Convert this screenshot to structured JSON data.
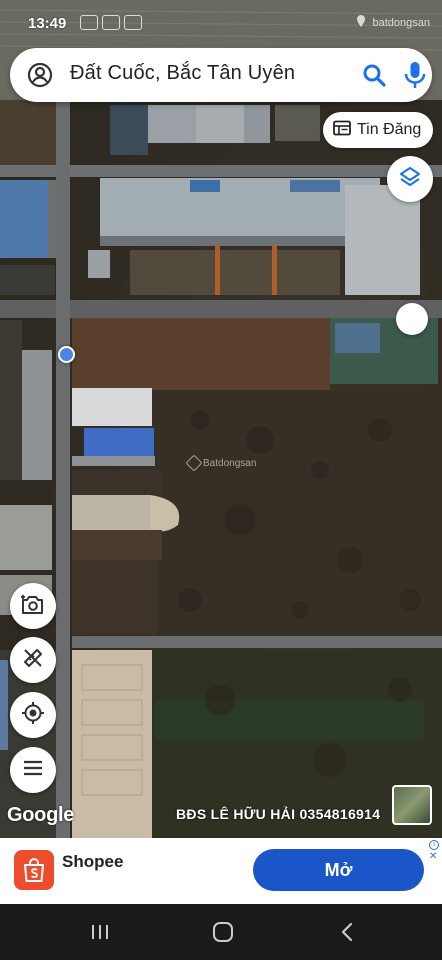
{
  "status_bar": {
    "time": "13:49",
    "carrier_mark": "batdongsan"
  },
  "search": {
    "query": "Đất Cuốc, Bắc Tân Uyên"
  },
  "tin_dang": {
    "label": "Tin Đăng"
  },
  "map": {
    "watermark": "Batdongsan",
    "google_logo": "Google",
    "caption": "BĐS LÊ HỮU HẢI 0354816914"
  },
  "ad": {
    "app_name": "Shopee",
    "open_label": "Mở",
    "info_symbol": "i",
    "close_symbol": "✕",
    "brand_color": "#ee4d2d",
    "button_color": "#1a56c8"
  },
  "icons": {
    "account": "account-circle-icon",
    "search": "search-icon",
    "mic": "mic-icon",
    "listing": "listing-icon",
    "layers": "layers-icon",
    "camera": "add-photo-icon",
    "measure": "measure-icon",
    "locate": "my-location-icon",
    "menu": "menu-icon",
    "recents": "recents-icon",
    "home": "home-icon",
    "back": "back-icon"
  }
}
